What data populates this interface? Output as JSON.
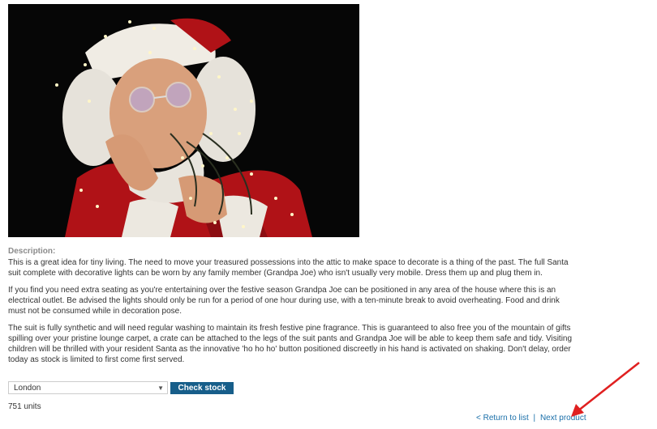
{
  "product": {
    "image_alt": "Man in Santa suit wrapped in fairy lights",
    "description_heading": "Description:",
    "paragraphs": [
      "This is a great idea for tiny living. The need to move your treasured possessions into the attic to make space to decorate is a thing of the past. The full Santa suit complete with decorative lights can be worn by any family member (Grandpa Joe) who isn't usually very mobile. Dress them up and plug them in.",
      "If you find you need extra seating as you're entertaining over the festive season Grandpa Joe can be positioned in any area of the house where this is an electrical outlet. Be advised the lights should only be run for a period of one hour during use, with a ten-minute break to avoid overheating. Food and drink must not be consumed while in decoration pose.",
      "The suit is fully synthetic and will need regular washing to maintain its fresh festive pine fragrance. This is guaranteed to also free you of the mountain of gifts spilling over your pristine lounge carpet, a crate can be attached to the legs of the suit pants and Grandpa Joe will be able to keep them safe and tidy. Visiting children will be thrilled with your resident Santa as the innovative 'ho ho ho' button positioned discreetly in his hand is activated on shaking. Don't delay, order today as stock is limited to first come first served."
    ]
  },
  "stock": {
    "selected_city": "London",
    "check_label": "Check stock",
    "result": "751 units"
  },
  "nav": {
    "return_label": "< Return to list",
    "separator": "|",
    "next_label": "Next product"
  },
  "colors": {
    "button_bg": "#175e8a",
    "link": "#1a6fa9",
    "arrow": "#e02020"
  }
}
